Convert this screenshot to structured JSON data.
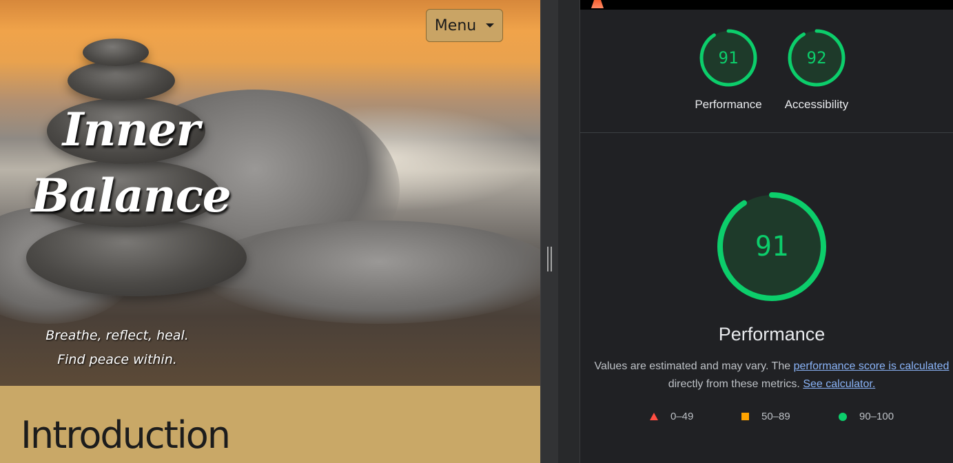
{
  "site": {
    "menu_label": "Menu",
    "title_line1": "Inner",
    "title_line2": "Balance",
    "tagline_line1": "Breathe, reflect, heal.",
    "tagline_line2": "Find peace within.",
    "intro_heading": "Introduction",
    "accent_color": "#c9a867"
  },
  "lighthouse": {
    "scores": [
      {
        "label": "Performance",
        "value": 91
      },
      {
        "label": "Accessibility",
        "value": 92
      }
    ],
    "focus": {
      "label": "Performance",
      "value": 91
    },
    "desc_prefix": "Values are estimated and may vary. The ",
    "desc_link1": "performance score is calculated",
    "desc_middle": " directly from these metrics. ",
    "desc_link2": "See calculator.",
    "legend": [
      {
        "range": "0–49",
        "shape": "triangle",
        "color": "#ff4e42"
      },
      {
        "range": "50–89",
        "shape": "square",
        "color": "#ffa400"
      },
      {
        "range": "90–100",
        "shape": "circle",
        "color": "#0cce6b"
      }
    ],
    "pass_color": "#0cce6b"
  }
}
